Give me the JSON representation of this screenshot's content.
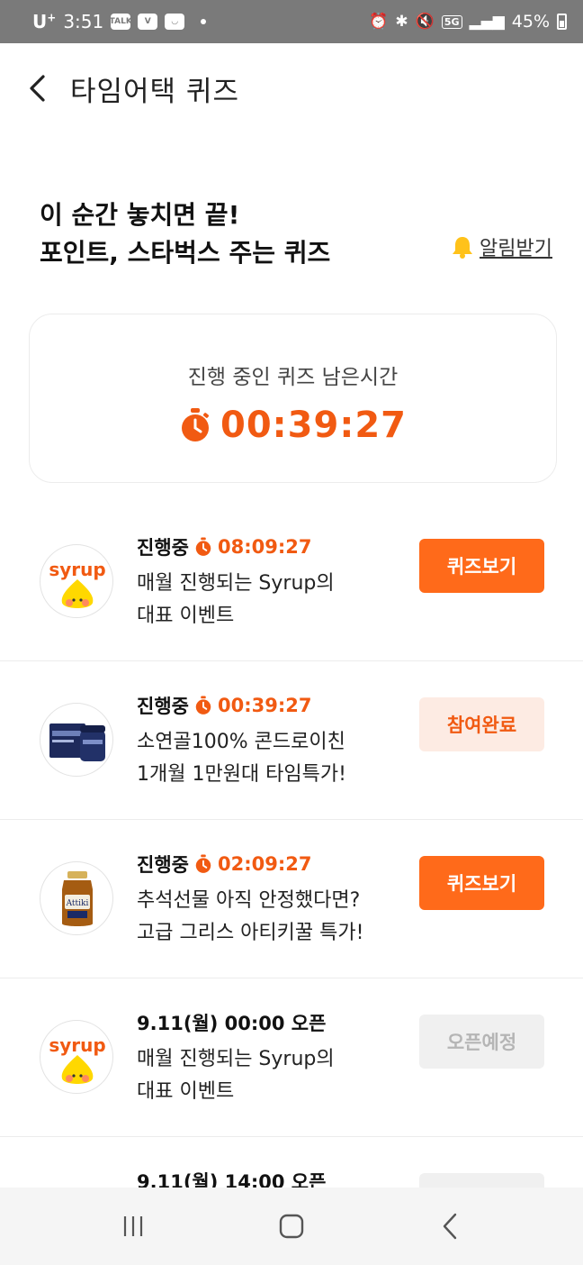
{
  "status_bar": {
    "carrier": "U",
    "carrier_sup": "+",
    "time": "3:51",
    "app_icons": [
      "TALK",
      "V",
      "◡"
    ],
    "network": "5G",
    "battery": "45%"
  },
  "header": {
    "title": "타임어택 퀴즈"
  },
  "hero": {
    "line1": "이 순간 놓치면 끝!",
    "line2": "포인트, 스타벅스 주는 퀴즈",
    "alarm_label": "알림받기"
  },
  "timer": {
    "label": "진행 중인 퀴즈 남은시간",
    "value": "00:39:27"
  },
  "quizzes": [
    {
      "thumb": "syrup-logo",
      "status": "진행중",
      "time": "08:09:27",
      "desc_line1": "매월 진행되는 Syrup의",
      "desc_line2": "대표 이벤트",
      "button": "퀴즈보기",
      "button_state": "active"
    },
    {
      "thumb": "supplement-product",
      "status": "진행중",
      "time": "00:39:27",
      "desc_line1": "소연골100% 콘드로이친",
      "desc_line2": "1개월 1만원대 타임특가!",
      "button": "참여완료",
      "button_state": "done"
    },
    {
      "thumb": "honey-jar",
      "status": "진행중",
      "time": "02:09:27",
      "desc_line1": "추석선물 아직 안정했다면?",
      "desc_line2": "고급 그리스 아티키꿀 특가!",
      "button": "퀴즈보기",
      "button_state": "active"
    },
    {
      "thumb": "syrup-logo",
      "status": "9.11(월) 00:00 오픈",
      "time": "",
      "desc_line1": "매월 진행되는 Syrup의",
      "desc_line2": "대표 이벤트",
      "button": "오픈예정",
      "button_state": "upcoming"
    },
    {
      "thumb": "",
      "status": "9.11(월) 14:00 오픈",
      "time": "",
      "desc_line1": "",
      "desc_line2": "",
      "button": "",
      "button_state": "upcoming"
    }
  ],
  "colors": {
    "accent": "#f15a12",
    "button_active": "#ff6a1a",
    "button_done_bg": "#fdebe3",
    "button_upcoming_bg": "#f0f0f0"
  },
  "nav": {
    "icons": [
      "recent-apps-icon",
      "home-icon",
      "back-icon"
    ]
  }
}
